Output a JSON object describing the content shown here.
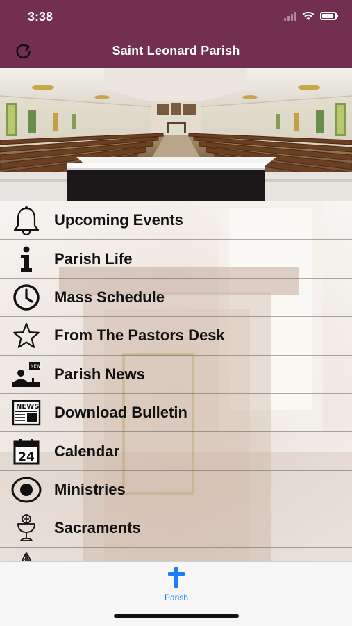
{
  "status_bar": {
    "time": "3:38"
  },
  "header": {
    "title": "Saint Leonard Parish",
    "refresh_icon": "refresh-icon"
  },
  "colors": {
    "header_bg": "#722f4f",
    "tab_active": "#1a7ef7",
    "tabbar_bg": "#f6f6f7"
  },
  "menu": {
    "items": [
      {
        "label": "Upcoming Events",
        "icon": "bell-icon"
      },
      {
        "label": "Parish Life",
        "icon": "info-icon"
      },
      {
        "label": "Mass Schedule",
        "icon": "clock-icon"
      },
      {
        "label": "From The Pastors Desk",
        "icon": "star-icon"
      },
      {
        "label": "Parish News",
        "icon": "news-anchor-icon"
      },
      {
        "label": "Download Bulletin",
        "icon": "newspaper-icon"
      },
      {
        "label": "Calendar",
        "icon": "calendar-icon"
      },
      {
        "label": "Ministries",
        "icon": "target-icon"
      },
      {
        "label": "Sacraments",
        "icon": "chalice-icon"
      },
      {
        "label": "",
        "icon": "praying-hands-icon"
      }
    ],
    "calendar_day": "24",
    "newspaper_text": "NEWS"
  },
  "tabbar": {
    "tabs": [
      {
        "label": "Parish",
        "icon": "cross-icon",
        "active": true
      }
    ]
  }
}
